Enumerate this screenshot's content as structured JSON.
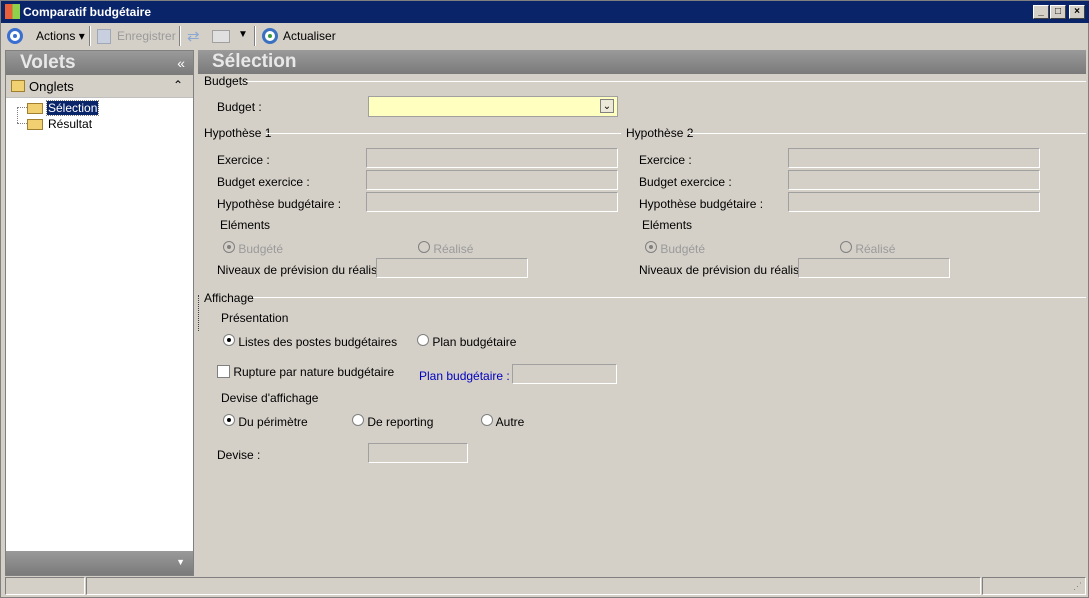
{
  "window": {
    "title": "Comparatif budgétaire"
  },
  "toolbar": {
    "actions": "Actions",
    "save": "Enregistrer",
    "refresh": "Actualiser"
  },
  "left": {
    "title": "Volets",
    "section": "Onglets",
    "items": [
      {
        "label": "Sélection",
        "selected": true
      },
      {
        "label": "Résultat",
        "selected": false
      }
    ]
  },
  "main": {
    "title": "Sélection",
    "budgets": {
      "group": "Budgets",
      "budget_label": "Budget :",
      "budget_value": ""
    },
    "h1": {
      "group": "Hypothèse 1",
      "exercice": "Exercice :",
      "budget_ex": "Budget exercice :",
      "hyp": "Hypothèse budgétaire :",
      "elements": "Eléments",
      "budgete": "Budgété",
      "realise": "Réalisé",
      "niveaux": "Niveaux de prévision du réalisé :"
    },
    "h2": {
      "group": "Hypothèse 2",
      "exercice": "Exercice :",
      "budget_ex": "Budget exercice :",
      "hyp": "Hypothèse budgétaire :",
      "elements": "Eléments",
      "budgete": "Budgété",
      "realise": "Réalisé",
      "niveaux": "Niveaux de prévision du réalisé :"
    },
    "affichage": {
      "group": "Affichage",
      "presentation": "Présentation",
      "opt_listes": "Listes des postes budgétaires",
      "opt_plan": "Plan budgétaire",
      "rupture": "Rupture par nature budgétaire",
      "plan_label": "Plan budgétaire :",
      "devise_aff": "Devise d'affichage",
      "opt_perimetre": "Du périmètre",
      "opt_reporting": "De reporting",
      "opt_autre": "Autre",
      "devise_label": "Devise :"
    }
  },
  "colors": {
    "title_bar": "#0a246a",
    "budget_field": "#ffffc0",
    "link_label": "#0000c0"
  }
}
